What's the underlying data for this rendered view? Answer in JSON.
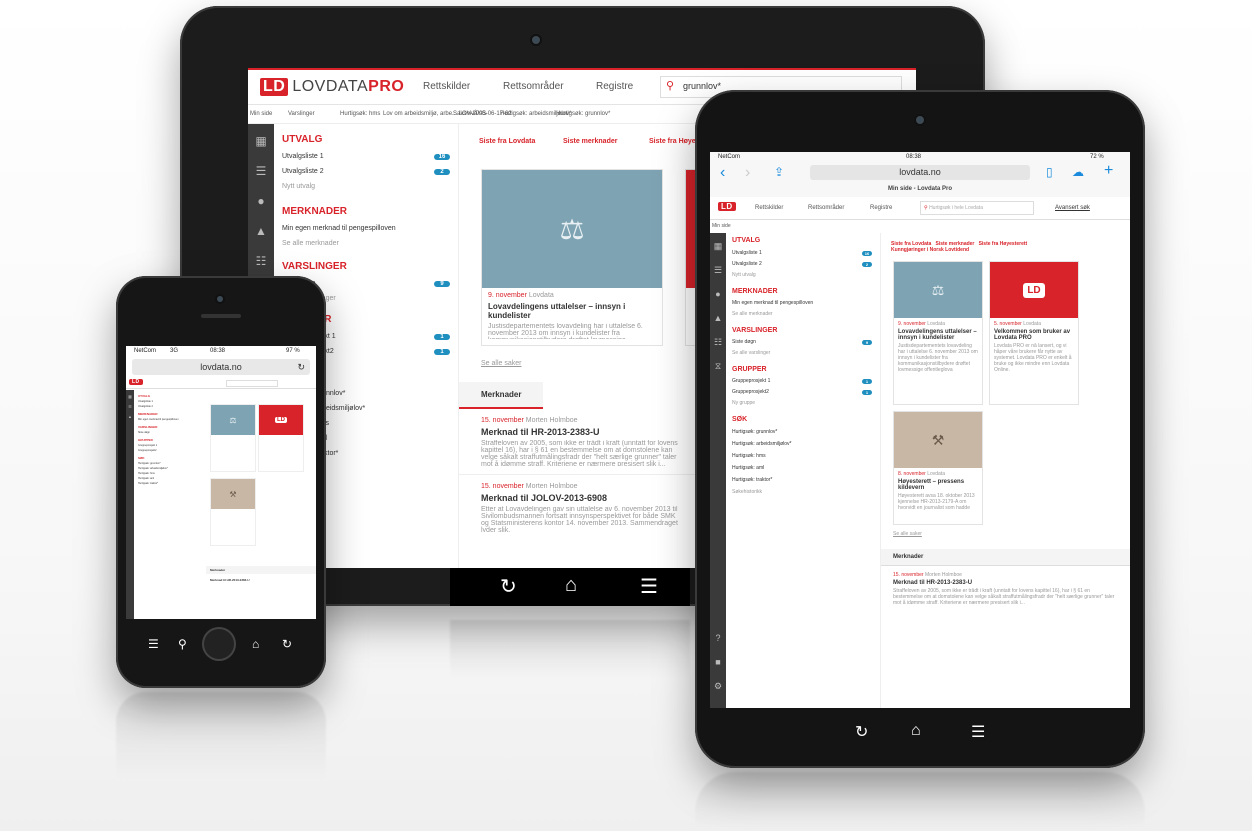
{
  "colors": {
    "brand": "#d8232a",
    "badge": "#1f8fc0",
    "sidebar": "#3a3a3a"
  },
  "brand": {
    "mark": "LD",
    "name": "LOVDATA",
    "pro": "PRO"
  },
  "nav": {
    "rettskilder": "Rettskilder",
    "rettsomrader": "Rettsområder",
    "registre": "Registre",
    "search_value": "grunnlov*",
    "search_placeholder": "Hurtigsøk i hele Lovdata",
    "advanced": "Avansert søk"
  },
  "breadcrumb": {
    "home": "Min side",
    "items": [
      "Varslinger",
      "Hurtigsøk: hms",
      "Lov om arbeidsmiljø, arbe... LOV-2005-06-17-62",
      "Saksnivå/sts",
      "Hurtigsøk: arbeidsmiljølov*",
      "Hurtigsøk: grunnlov*"
    ]
  },
  "sidebar_icons": [
    "dashboard-icon",
    "list-icon",
    "comment-icon",
    "bell-icon",
    "group-icon",
    "filter-icon"
  ],
  "utvalg": {
    "title": "UTVALG",
    "items": [
      {
        "label": "Utvalgsliste 1",
        "count": "16"
      },
      {
        "label": "Utvalgsliste 2",
        "count": "2"
      }
    ],
    "new": "Nytt utvalg"
  },
  "merknader": {
    "title": "MERKNADER",
    "item": "Min egen merknad til pengespilloven",
    "see_all": "Se alle merknader"
  },
  "varslinger": {
    "title": "VARSLINGER",
    "item": "Siste døgn",
    "count": "9",
    "see_all": "Se alle varslinger"
  },
  "grupper": {
    "title": "GRUPPER",
    "items": [
      {
        "label": "Gruppeprosjekt 1",
        "count": "1"
      },
      {
        "label": "Gruppeprosjekt2",
        "count": "1"
      }
    ],
    "new": "Ny gruppe"
  },
  "sok": {
    "title": "SØK",
    "items": [
      "Hurtigsøk: grunnlov*",
      "Hurtigsøk: arbeidsmiljølov*",
      "Hurtigsøk: hms",
      "Hurtigsøk: aml",
      "Hurtigsøk: traktor*"
    ],
    "more": "Søkehistorikk"
  },
  "tabs": {
    "siste_lovdata": "Siste fra Lovdata",
    "siste_merknader": "Siste merknader",
    "siste_hr": "Siste fra Høyesterett",
    "kunngjoringer": "Kunngjøringer i Norsk Lovtidend"
  },
  "cards": [
    {
      "date": "9. november",
      "source": "Lovdata",
      "title": "Lovavdelingens uttalelser – innsyn i kundelister",
      "text": "Justisdepartementets lovavdeling har i uttalelse 6. november 2013 om innsyn i kundelister fra kommunikasjonstilbydere drøftet lovmessige offentleglova"
    },
    {
      "date": "5. november",
      "source": "Lovdata",
      "title": "Velkommen som bruker av Lovdata PRO",
      "text": "Lovdata PRO er nå lansert, og vi håper våre brukere får nytte av systemet. Lovdata PRO er enkelt å bruke og ikke mindre enn Lovdata Online."
    },
    {
      "date": "8. november",
      "source": "Lovdata",
      "title": "Høyesterett – pressens kildevern",
      "text": "Høyesterett avsa 18. oktober 2013 kjennelse HR-2013-2179-A om hvorvidt en journalist som hadde innhold tilbud om politidokumenter i 22. juli-saken kunne nekte å oppgi kilden til Spesialenheten for politisaker."
    }
  ],
  "see_all_news": "Se alle saker",
  "merknader_feed": {
    "title": "Merknader",
    "items": [
      {
        "date": "15. november",
        "author": "Morten Holmboe",
        "title": "Merknad til HR-2013-2383-U",
        "text": "Straffeloven av 2005, som ikke er trådt i kraft (unntatt for lovens kapittel 16), har i § 61 en bestemmelse om at domstolene kan velge såkalt straffutmålingsfradr der \"helt særlige grunner\" taler mot å idømme straff. Kriteriene er nærmere presisert slik i..."
      },
      {
        "date": "15. november",
        "author": "Morten Holmboe",
        "title": "Merknad til JOLOV-2013-6908",
        "text": "Etter at Lovavdelingen gav sin uttalelse av 6. november 2013 til Sivilombudsmannen fortsatt innsynsperspektivet for både SMK og Statsministerens kontor 14. november 2013. Sammendraget lyder slik."
      }
    ]
  },
  "ios": {
    "carrier": "NetCom",
    "time": "08:38",
    "battery_tablet": "72 %",
    "battery_phone": "97 %",
    "network": "3G",
    "url": "lovdata.no",
    "page_title": "Min side - Lovdata Pro"
  }
}
